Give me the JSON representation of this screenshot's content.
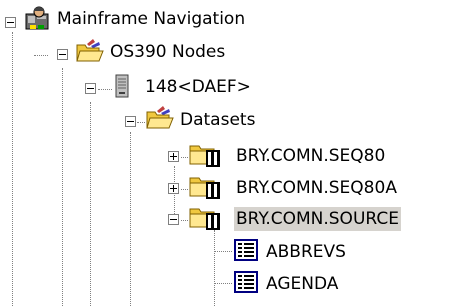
{
  "tree": {
    "nodes": [
      {
        "label": "Mainframe Navigation",
        "icon": "mainframe-navigation-icon",
        "expanded": true
      },
      {
        "label": "OS390 Nodes",
        "icon": "open-folder-icon",
        "expanded": true
      },
      {
        "label": "148<DAEF>",
        "icon": "server-icon",
        "expanded": true
      },
      {
        "label": "Datasets",
        "icon": "open-folder-icon",
        "expanded": true
      },
      {
        "label": "BRY.COMN.SEQ80",
        "icon": "dataset-folder-icon",
        "expanded": false
      },
      {
        "label": "BRY.COMN.SEQ80A",
        "icon": "dataset-folder-icon",
        "expanded": false
      },
      {
        "label": "BRY.COMN.SOURCE",
        "icon": "dataset-folder-icon",
        "expanded": true,
        "selected": true
      },
      {
        "label": "ABBREVS",
        "icon": "member-document-icon"
      },
      {
        "label": "AGENDA",
        "icon": "member-document-icon"
      }
    ]
  },
  "colors": {
    "selection_bg": "#d6d3ce",
    "folder_yellow": "#f0c840",
    "tree_line": "#808080",
    "member_blue": "#000080"
  }
}
